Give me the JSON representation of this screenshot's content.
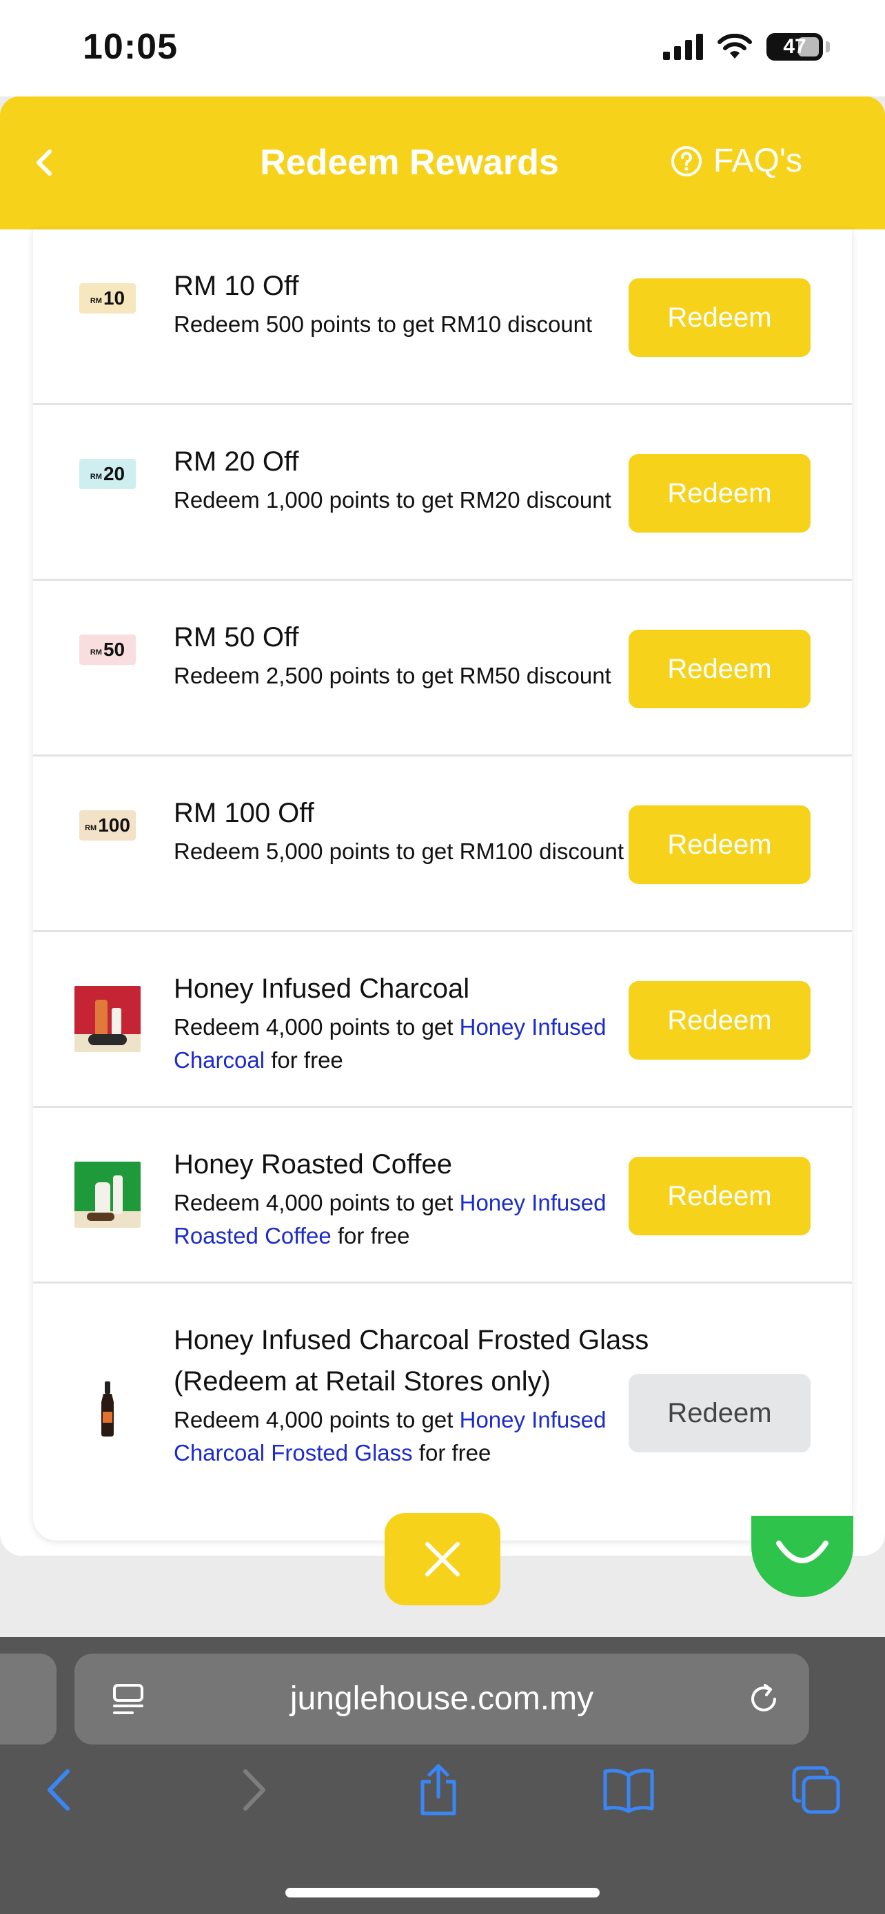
{
  "status_bar": {
    "time": "10:05",
    "battery": "47"
  },
  "header": {
    "title": "Redeem Rewards",
    "faq_label": "FAQ's"
  },
  "colors": {
    "accent": "#f7d21b",
    "link": "#1c2bcc",
    "disabled": "#e4e6e8"
  },
  "rewards": [
    {
      "title": "RM 10 Off",
      "desc": "Redeem 500 points to get RM10 discount",
      "button": "Redeem",
      "voucher_value": "10",
      "voucher_prefix": "RM"
    },
    {
      "title": "RM 20 Off",
      "desc": "Redeem 1,000 points to get RM20 discount",
      "button": "Redeem",
      "voucher_value": "20",
      "voucher_prefix": "RM"
    },
    {
      "title": "RM 50 Off",
      "desc": "Redeem 2,500 points to get RM50 discount",
      "button": "Redeem",
      "voucher_value": "50",
      "voucher_prefix": "RM"
    },
    {
      "title": "RM 100 Off",
      "desc": "Redeem 5,000 points to get RM100 discount",
      "button": "Redeem",
      "voucher_value": "100",
      "voucher_prefix": "RM"
    },
    {
      "title": "Honey Infused Charcoal",
      "desc_prefix": "Redeem 4,000 points to get ",
      "desc_link": "Honey Infused Charcoal",
      "desc_suffix": " for free",
      "button": "Redeem"
    },
    {
      "title": "Honey Roasted Coffee",
      "desc_prefix": "Redeem 4,000 points to get ",
      "desc_link": "Honey Infused Roasted Coffee",
      "desc_suffix": " for free",
      "button": "Redeem"
    },
    {
      "title": "Honey Infused Charcoal Frosted Glass (Redeem at Retail Stores only)",
      "desc_prefix": "Redeem 4,000 points to get ",
      "desc_link": "Honey Infused Charcoal Frosted Glass",
      "desc_suffix": " for free",
      "button": "Redeem",
      "disabled": true
    }
  ],
  "browser": {
    "url": "junglehouse.com.my"
  }
}
